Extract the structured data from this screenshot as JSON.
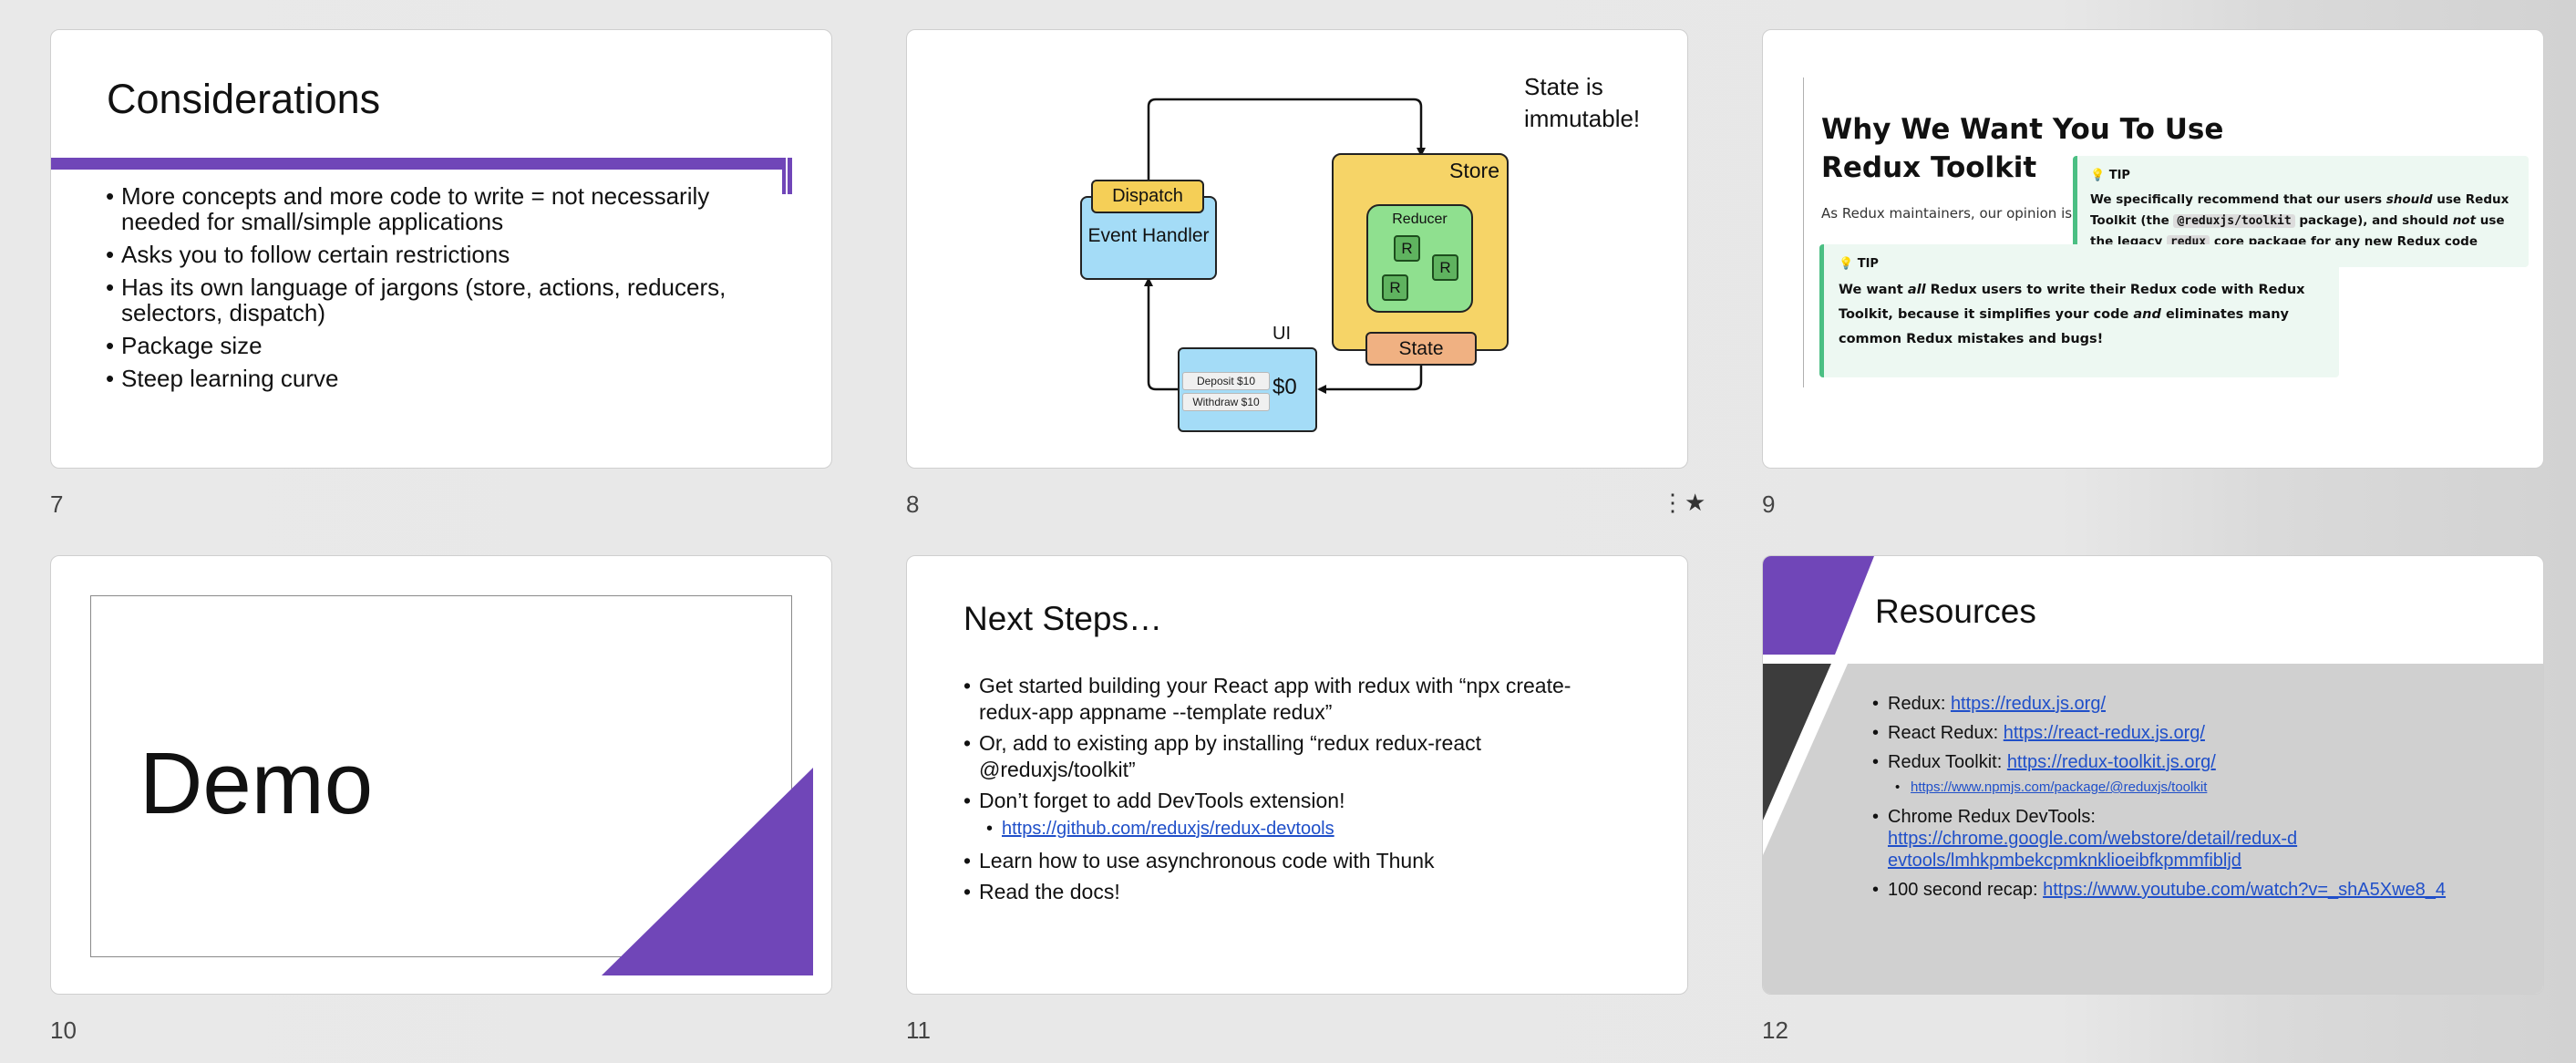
{
  "slides": [
    {
      "number": "7",
      "title": "Considerations",
      "bullets": [
        "More concepts and more code to write = not necessarily needed for small/simple applications",
        "Asks you to follow certain restrictions",
        "Has its own language of jargons (store, actions, reducers, selectors, dispatch)",
        "Package size",
        "Steep learning curve"
      ],
      "accent": "#7046b8"
    },
    {
      "number": "8",
      "note": "State is immutable!",
      "labels": {
        "dispatch": "Dispatch",
        "event_handler": "Event Handler",
        "store": "Store",
        "reducer": "Reducer",
        "r": "R",
        "state": "State",
        "ui": "UI",
        "deposit": "Deposit $10",
        "withdraw": "Withdraw $10",
        "balance": "$0"
      },
      "colors": {
        "dispatch": "#f5cf57",
        "event_handler": "#a4dcf7",
        "store": "#f6d467",
        "reducer": "#8fe08f",
        "state": "#f0b182",
        "ui": "#a4dcf7"
      },
      "favorite_icon": "star-icon"
    },
    {
      "number": "9",
      "title": "Why We Want You To Use Redux Toolkit",
      "intro": "As Redux maintainers, our opinion is:",
      "tip1": {
        "label": "TIP",
        "t1": "We specifically recommend that our users ",
        "t2": "should",
        "t3": " use Redux Toolkit (the ",
        "code1": "@reduxjs/toolkit",
        "t4": " package), and should ",
        "t5": "not",
        "t6": " use the legacy ",
        "code2": "redux",
        "t7": " core package for any new Redux code today!"
      },
      "tip2": {
        "label": "TIP",
        "t1": "We want ",
        "t2": "all",
        "t3": " Redux users to write their Redux code with Redux Toolkit, because it simplifies your code ",
        "t4": "and",
        "t5": " eliminates many common Redux mistakes and bugs!"
      },
      "tip_color": "#4bbf83"
    },
    {
      "number": "10",
      "title": "Demo",
      "accent": "#7046b8"
    },
    {
      "number": "11",
      "title": "Next Steps…",
      "bullets": [
        "Get started building your React app with redux with “npx create-redux-app appname --template redux”",
        "Or, add to existing app by installing “redux redux-react @reduxjs/toolkit”",
        "Don’t forget to add DevTools extension!"
      ],
      "sub_link": "https://github.com/reduxjs/redux-devtools",
      "bullets_after": [
        "Learn how to use asynchronous code with Thunk",
        "Read the docs!"
      ]
    },
    {
      "number": "12",
      "title": "Resources",
      "items": [
        {
          "label": "Redux: ",
          "link": "https://redux.js.org/"
        },
        {
          "label": "React Redux: ",
          "link": "https://react-redux.js.org/"
        },
        {
          "label": "Redux Toolkit: ",
          "link": "https://redux-toolkit.js.org/"
        }
      ],
      "sub_link": "https://www.npmjs.com/package/@reduxjs/toolkit",
      "chrome_label": "Chrome Redux DevTools:",
      "chrome_link": "https://chrome.google.com/webstore/detail/redux-devtools/lmhkpmbekcpmknklioeibfkpmmfibljd",
      "recap_label": "100 second recap: ",
      "recap_link": "https://www.youtube.com/watch?v=_shA5Xwe8_4",
      "colors": {
        "purple": "#7046b8",
        "dark": "#3c3c3c",
        "panel": "#d0d0d0"
      }
    }
  ]
}
